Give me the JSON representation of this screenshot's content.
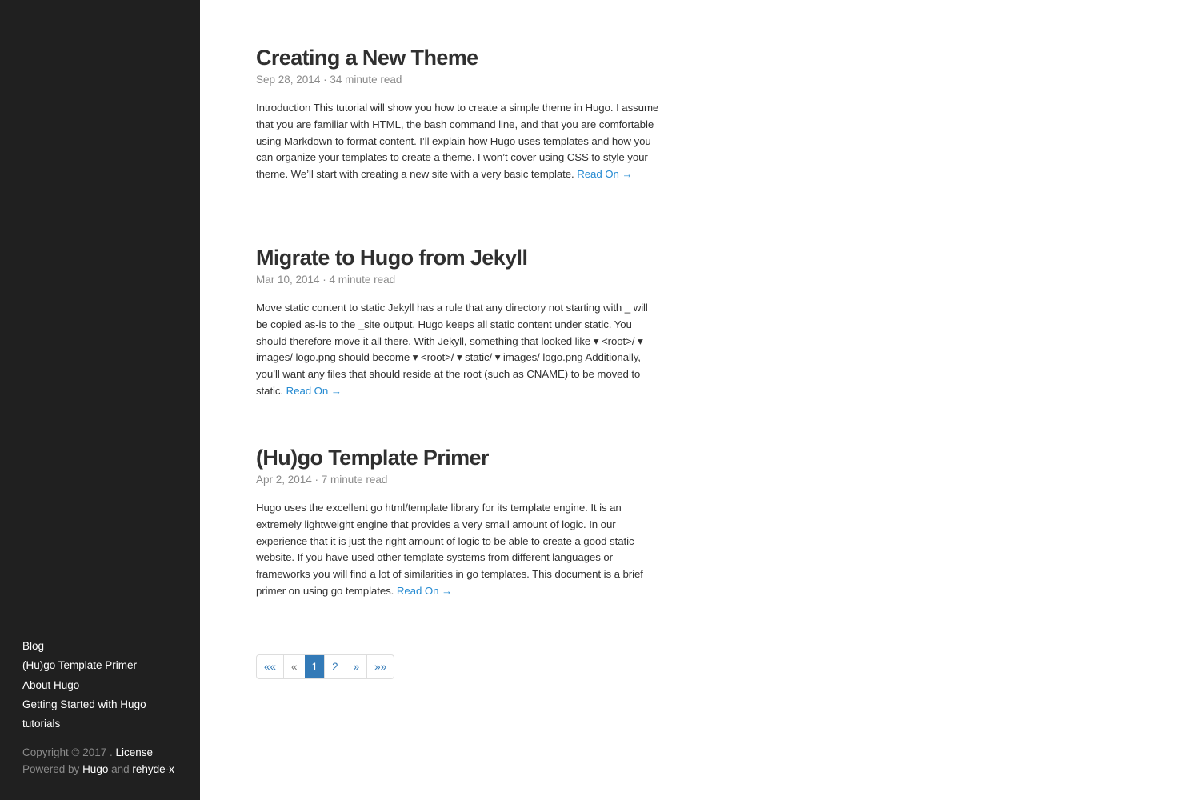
{
  "sidebar": {
    "nav": [
      "Blog",
      "(Hu)go Template Primer",
      "About Hugo",
      "Getting Started with Hugo",
      "tutorials"
    ],
    "copyright": "Copyright © 2017 .",
    "license": "License",
    "powered_by": "Powered by",
    "hugo": "Hugo",
    "and": "and",
    "theme": "rehyde-x"
  },
  "posts": [
    {
      "title": "Creating a New Theme",
      "meta": "Sep 28, 2014 · 34 minute read",
      "summary": "Introduction This tutorial will show you how to create a simple theme in Hugo. I assume that you are familiar with HTML, the bash command line, and that you are comfortable using Markdown to format content. I’ll explain how Hugo uses templates and how you can organize your templates to create a theme. I won’t cover using CSS to style your theme. We’ll start with creating a new site with a very basic template.",
      "read_on": "Read On →"
    },
    {
      "title": "Migrate to Hugo from Jekyll",
      "meta": "Mar 10, 2014 · 4 minute read",
      "summary": "Move static content to static Jekyll has a rule that any directory not starting with _ will be copied as-is to the _site output. Hugo keeps all static content under static. You should therefore move it all there. With Jekyll, something that looked like ▾ <root>/ ▾ images/ logo.png should become ▾ <root>/ ▾ static/ ▾ images/ logo.png Additionally, you’ll want any files that should reside at the root (such as CNAME) to be moved to static.",
      "read_on": "Read On →"
    },
    {
      "title": "(Hu)go Template Primer",
      "meta": "Apr 2, 2014 · 7 minute read",
      "summary": "Hugo uses the excellent go html/template library for its template engine. It is an extremely lightweight engine that provides a very small amount of logic. In our experience that it is just the right amount of logic to be able to create a good static website. If you have used other template systems from different languages or frameworks you will find a lot of similarities in go templates. This document is a brief primer on using go templates.",
      "read_on": "Read On →"
    }
  ],
  "pagination": {
    "first": "««",
    "prev": "«",
    "pages": [
      "1",
      "2"
    ],
    "current": "1",
    "next": "»",
    "last": "»»"
  },
  "colors": {
    "sidebar_bg": "#202020",
    "link": "#268bd2",
    "active_page": "#337ab7"
  }
}
